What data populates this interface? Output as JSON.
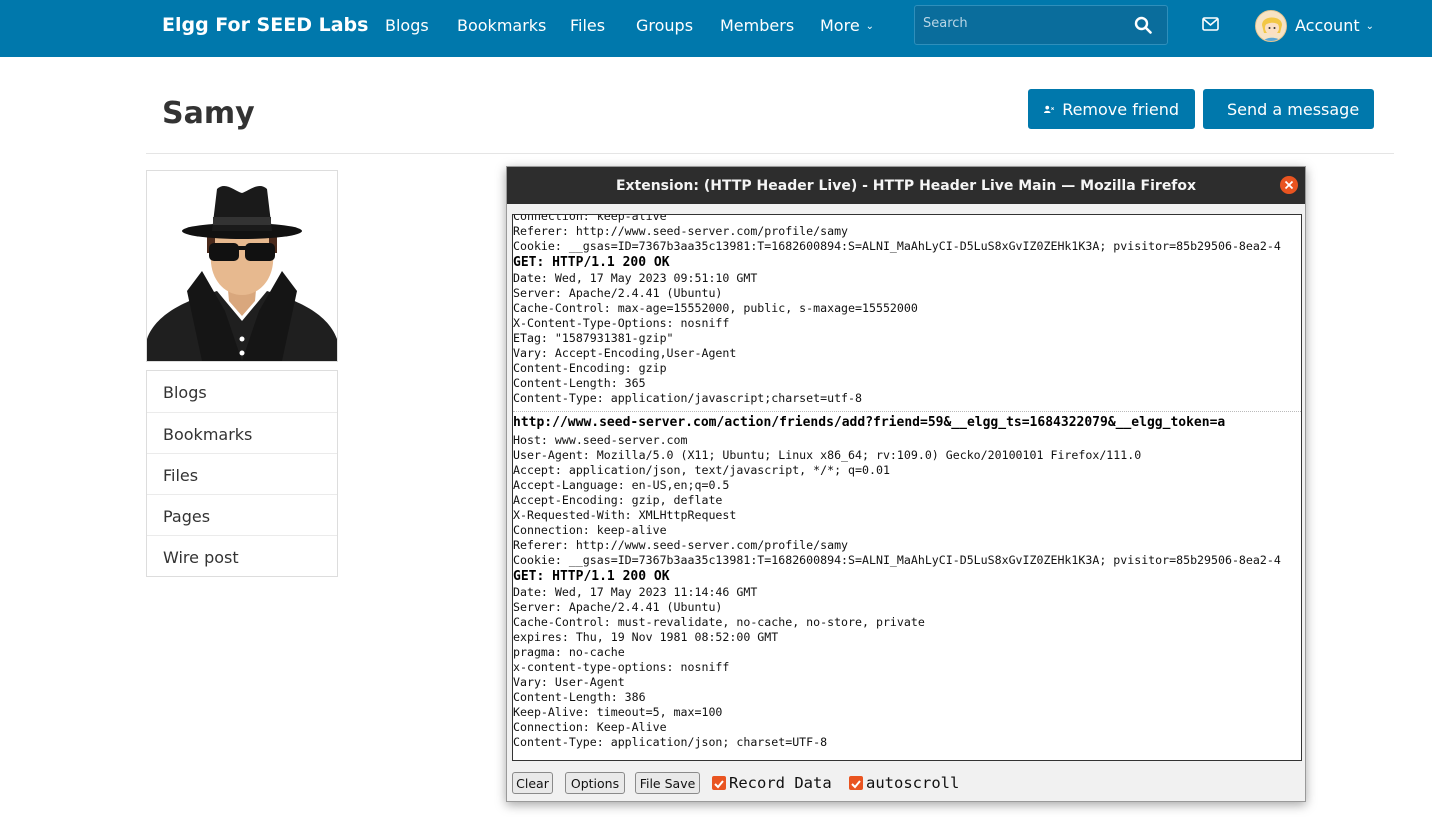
{
  "nav": {
    "brand": "Elgg For SEED Labs",
    "items": [
      "Blogs",
      "Bookmarks",
      "Files",
      "Groups",
      "Members",
      "More"
    ],
    "search_placeholder": "Search",
    "account_label": "Account"
  },
  "profile": {
    "name": "Samy",
    "remove_friend_label": "Remove friend",
    "send_message_label": "Send a message",
    "menu": [
      "Blogs",
      "Bookmarks",
      "Files",
      "Pages",
      "Wire post"
    ]
  },
  "extension": {
    "title": "Extension: (HTTP Header Live) - HTTP Header Live Main — Mozilla Firefox",
    "log": {
      "block1_top": [
        "Connection: keep-alive",
        "Referer: http://www.seed-server.com/profile/samy",
        "Cookie: __gsas=ID=7367b3aa35c13981:T=1682600894:S=ALNI_MaAhLyCI-D5LuS8xGvIZ0ZEHk1K3A; pvisitor=85b29506-8ea2-4"
      ],
      "block1_status": "GET: HTTP/1.1 200 OK",
      "block1_headers": [
        "Date: Wed, 17 May 2023 09:51:10 GMT",
        "Server: Apache/2.4.41 (Ubuntu)",
        "Cache-Control: max-age=15552000, public, s-maxage=15552000",
        "X-Content-Type-Options: nosniff",
        "ETag: \"1587931381-gzip\"",
        "Vary: Accept-Encoding,User-Agent",
        "Content-Encoding: gzip",
        "Content-Length: 365",
        "Content-Type: application/javascript;charset=utf-8"
      ],
      "block2_url": "http://www.seed-server.com/action/friends/add?friend=59&__elgg_ts=1684322079&__elgg_token=a",
      "block2_request": [
        "Host: www.seed-server.com",
        "User-Agent: Mozilla/5.0 (X11; Ubuntu; Linux x86_64; rv:109.0) Gecko/20100101 Firefox/111.0",
        "Accept: application/json, text/javascript, */*; q=0.01",
        "Accept-Language: en-US,en;q=0.5",
        "Accept-Encoding: gzip, deflate",
        "X-Requested-With: XMLHttpRequest",
        "Connection: keep-alive",
        "Referer: http://www.seed-server.com/profile/samy",
        "Cookie: __gsas=ID=7367b3aa35c13981:T=1682600894:S=ALNI_MaAhLyCI-D5LuS8xGvIZ0ZEHk1K3A; pvisitor=85b29506-8ea2-4"
      ],
      "block2_status": "GET: HTTP/1.1 200 OK",
      "block2_headers": [
        "Date: Wed, 17 May 2023 11:14:46 GMT",
        "Server: Apache/2.4.41 (Ubuntu)",
        "Cache-Control: must-revalidate, no-cache, no-store, private",
        "expires: Thu, 19 Nov 1981 08:52:00 GMT",
        "pragma: no-cache",
        "x-content-type-options: nosniff",
        "Vary: User-Agent",
        "Content-Length: 386",
        "Keep-Alive: timeout=5, max=100",
        "Connection: Keep-Alive",
        "Content-Type: application/json; charset=UTF-8"
      ]
    },
    "buttons": {
      "clear": "Clear",
      "options": "Options",
      "file_save": "File Save"
    },
    "record_data_label": "Record Data",
    "record_data_checked": true,
    "autoscroll_label": "autoscroll",
    "autoscroll_checked": true
  },
  "colors": {
    "nav_bg": "#0078ac",
    "button_bg": "#0078ac",
    "ubuntu_orange": "#e95420",
    "window_title_bg": "#2d2d2d"
  }
}
